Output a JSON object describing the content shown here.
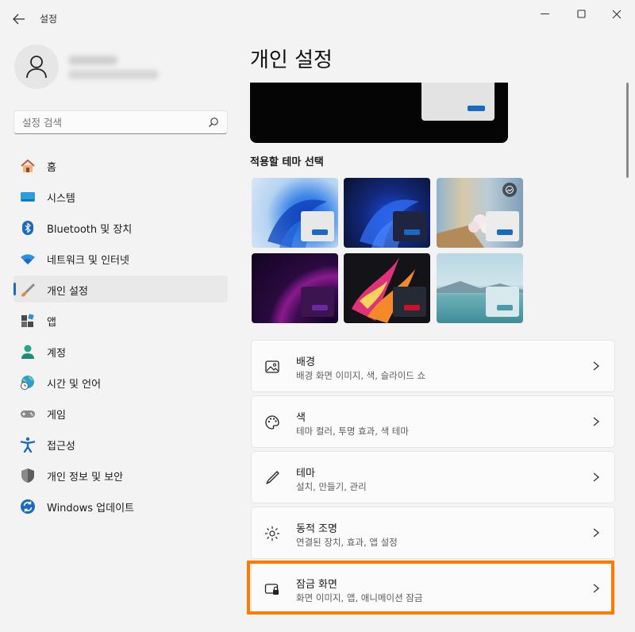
{
  "window": {
    "app_title": "설정",
    "back_icon": "back-arrow-icon",
    "controls": [
      "minimize-icon",
      "maximize-icon",
      "close-icon"
    ]
  },
  "sidebar": {
    "search_placeholder": "설정 검색",
    "items": [
      {
        "label": "홈",
        "icon": "home-icon",
        "active": false
      },
      {
        "label": "시스템",
        "icon": "system-icon",
        "active": false
      },
      {
        "label": "Bluetooth 및 장치",
        "icon": "bluetooth-icon",
        "active": false
      },
      {
        "label": "네트워크 및 인터넷",
        "icon": "wifi-icon",
        "active": false
      },
      {
        "label": "개인 설정",
        "icon": "brush-icon",
        "active": true
      },
      {
        "label": "앱",
        "icon": "apps-icon",
        "active": false
      },
      {
        "label": "계정",
        "icon": "account-icon",
        "active": false
      },
      {
        "label": "시간 및 언어",
        "icon": "globe-clock-icon",
        "active": false
      },
      {
        "label": "게임",
        "icon": "gamepad-icon",
        "active": false
      },
      {
        "label": "접근성",
        "icon": "accessibility-icon",
        "active": false
      },
      {
        "label": "개인 정보 및 보안",
        "icon": "shield-icon",
        "active": false
      },
      {
        "label": "Windows 업데이트",
        "icon": "update-icon",
        "active": false
      }
    ]
  },
  "main": {
    "page_title": "개인 설정",
    "themes_label": "적용할 테마 선택",
    "cards": [
      {
        "title": "배경",
        "subtitle": "배경 화면 이미지, 색, 슬라이드 쇼",
        "icon": "image-icon"
      },
      {
        "title": "색",
        "subtitle": "테마 컬러, 투명 효과, 색 테마",
        "icon": "palette-icon"
      },
      {
        "title": "테마",
        "subtitle": "설치, 만들기, 관리",
        "icon": "pen-icon"
      },
      {
        "title": "동적 조명",
        "subtitle": "연결된 장치, 효과, 앱 설정",
        "icon": "dynamic-lighting-icon"
      },
      {
        "title": "잠금 화면",
        "subtitle": "화면 이미지, 앱, 애니메이션 잠금",
        "icon": "lock-screen-icon"
      }
    ]
  },
  "colors": {
    "accent": "#1a6ac4",
    "highlight": "#ff7a00"
  }
}
